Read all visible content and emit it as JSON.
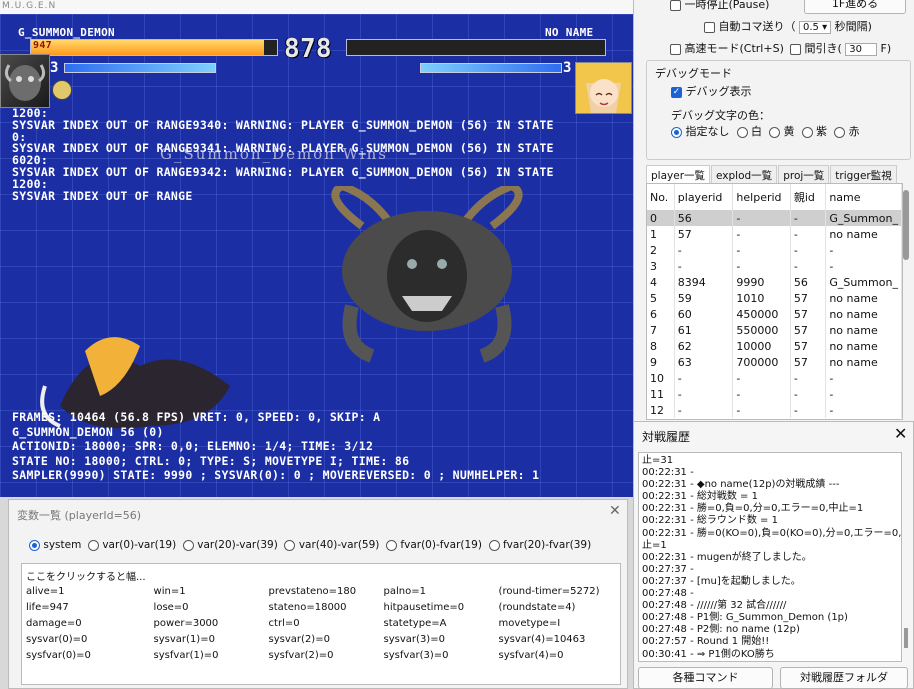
{
  "game": {
    "window_title": "M.U.G.E.N",
    "p1_name": "G_SUMMON_DEMON",
    "p2_name": "NO NAME",
    "p1_life": "947",
    "p1_life_fraction": 0.947,
    "p2_life_fraction": 0.0,
    "p1_power": "3",
    "p2_power": "3",
    "timer": "878",
    "error_lines": [
      "1200:",
      "SYSVAR INDEX OUT OF RANGE9340: WARNING: PLAYER G_SUMMON_DEMON (56) IN STATE",
      "0:",
      "SYSVAR INDEX OUT OF RANGE9341: WARNING: PLAYER G_SUMMON_DEMON (56) IN STATE",
      "6020:",
      "SYSVAR INDEX OUT OF RANGE9342: WARNING: PLAYER G_SUMMON_DEMON (56) IN STATE",
      "1200:",
      "SYSVAR INDEX OUT OF RANGE"
    ],
    "overlay_text": "G_Summon_Demon Wins",
    "debug_lines": [
      "FRAMES: 10464 (56.8 FPS) VRET: 0, SPEED: 0, SKIP: A",
      "G_SUMMON_DEMON 56 (0)",
      "ACTIONID: 18000; SPR: 0,0; ELEMNO: 1/4; TIME: 3/12",
      "STATE NO: 18000; CTRL: 0; TYPE: S; MOVETYPE I; TIME: 86",
      "SAMPLER(9990) STATE: 9990 ; SYSVAR(0): 0 ; MOVEREVERSED: 0 ; NUMHELPER: 1"
    ]
  },
  "controls": {
    "pause_label": "一時停止(Pause)",
    "step_button": "1F進める",
    "auto_step_label": "自動コマ送り（",
    "auto_step_value": "0.5",
    "auto_step_unit": "秒間隔)",
    "fast_mode_label": "高速モード(Ctrl+S)",
    "skip_label": "間引き(",
    "skip_value": "30",
    "skip_unit": "F)",
    "debug_mode_title": "デバッグモード",
    "debug_display_label": "デバッグ表示",
    "debug_color_title": "デバッグ文字の色：",
    "color_options": [
      "指定なし",
      "白",
      "黄",
      "紫",
      "赤"
    ]
  },
  "player_panel": {
    "tabs": [
      "player一覧",
      "explod一覧",
      "proj一覧",
      "trigger監視"
    ],
    "columns": [
      "No.",
      "playerid",
      "helperid",
      "親id",
      "name"
    ],
    "rows": [
      [
        "0",
        "56",
        "-",
        "-",
        "G_Summon_"
      ],
      [
        "1",
        "57",
        "-",
        "-",
        "no name"
      ],
      [
        "2",
        "-",
        "-",
        "-",
        "-"
      ],
      [
        "3",
        "-",
        "-",
        "-",
        "-"
      ],
      [
        "4",
        "8394",
        "9990",
        "56",
        "G_Summon_"
      ],
      [
        "5",
        "59",
        "1010",
        "57",
        "no name"
      ],
      [
        "6",
        "60",
        "450000",
        "57",
        "no name"
      ],
      [
        "7",
        "61",
        "550000",
        "57",
        "no name"
      ],
      [
        "8",
        "62",
        "10000",
        "57",
        "no name"
      ],
      [
        "9",
        "63",
        "700000",
        "57",
        "no name"
      ],
      [
        "10",
        "-",
        "-",
        "-",
        "-"
      ],
      [
        "11",
        "-",
        "-",
        "-",
        "-"
      ],
      [
        "12",
        "-",
        "-",
        "-",
        "-"
      ]
    ]
  },
  "history": {
    "title": "対戦履歴",
    "lines": [
      "止=31",
      "00:22:31 -",
      "00:22:31 - ◆no name(12p)の対戦成績 ---",
      "00:22:31 - 総対戦数 = 1",
      "00:22:31 - 勝=0,負=0,分=0,エラー=0,中止=1",
      "00:22:31 - 総ラウンド数 = 1",
      "00:22:31 - 勝=0(KO=0),負=0(KO=0),分=0,エラー=0,中",
      "止=1",
      "00:22:31 - mugenが終了しました。",
      "00:27:37 -",
      "00:27:37 - [mu]を起動しました。",
      "00:27:48 -",
      "00:27:48 - //////第 32 試合//////",
      "00:27:48 - P1側: G_Summon_Demon (1p)",
      "00:27:48 - P2側: no name (12p)",
      "00:27:57 - Round 1 開始!!",
      "00:30:41 - ⇒ P1側のKO勝ち"
    ],
    "button_commands": "各種コマンド",
    "button_folder": "対戦履歴フォルダ"
  },
  "vars": {
    "title": "変数一覧 (playerId=56)",
    "radio_options": [
      "system",
      "var(0)-var(19)",
      "var(20)-var(39)",
      "var(40)-var(59)",
      "fvar(0)-fvar(19)",
      "fvar(20)-fvar(39)"
    ],
    "rows": [
      [
        "ここをクリックすると幅...",
        "",
        "",
        "",
        ""
      ],
      [
        "alive=1",
        "win=1",
        "prevstateno=180",
        "palno=1",
        "(round-timer=5272)"
      ],
      [
        "life=947",
        "lose=0",
        "stateno=18000",
        "hitpausetime=0",
        "(roundstate=4)"
      ],
      [
        "damage=0",
        "power=3000",
        "ctrl=0",
        "statetype=A",
        "movetype=I"
      ],
      [
        "sysvar(0)=0",
        "sysvar(1)=0",
        "sysvar(2)=0",
        "sysvar(3)=0",
        "sysvar(4)=10463"
      ],
      [
        "sysfvar(0)=0",
        "sysfvar(1)=0",
        "sysfvar(2)=0",
        "sysfvar(3)=0",
        "sysfvar(4)=0"
      ]
    ]
  },
  "colors": {
    "arena_bg": "#1c2ea4",
    "life_bar": "#ffae2a",
    "power_bar": "#4aa8ff",
    "selection": "#1a63d6"
  }
}
